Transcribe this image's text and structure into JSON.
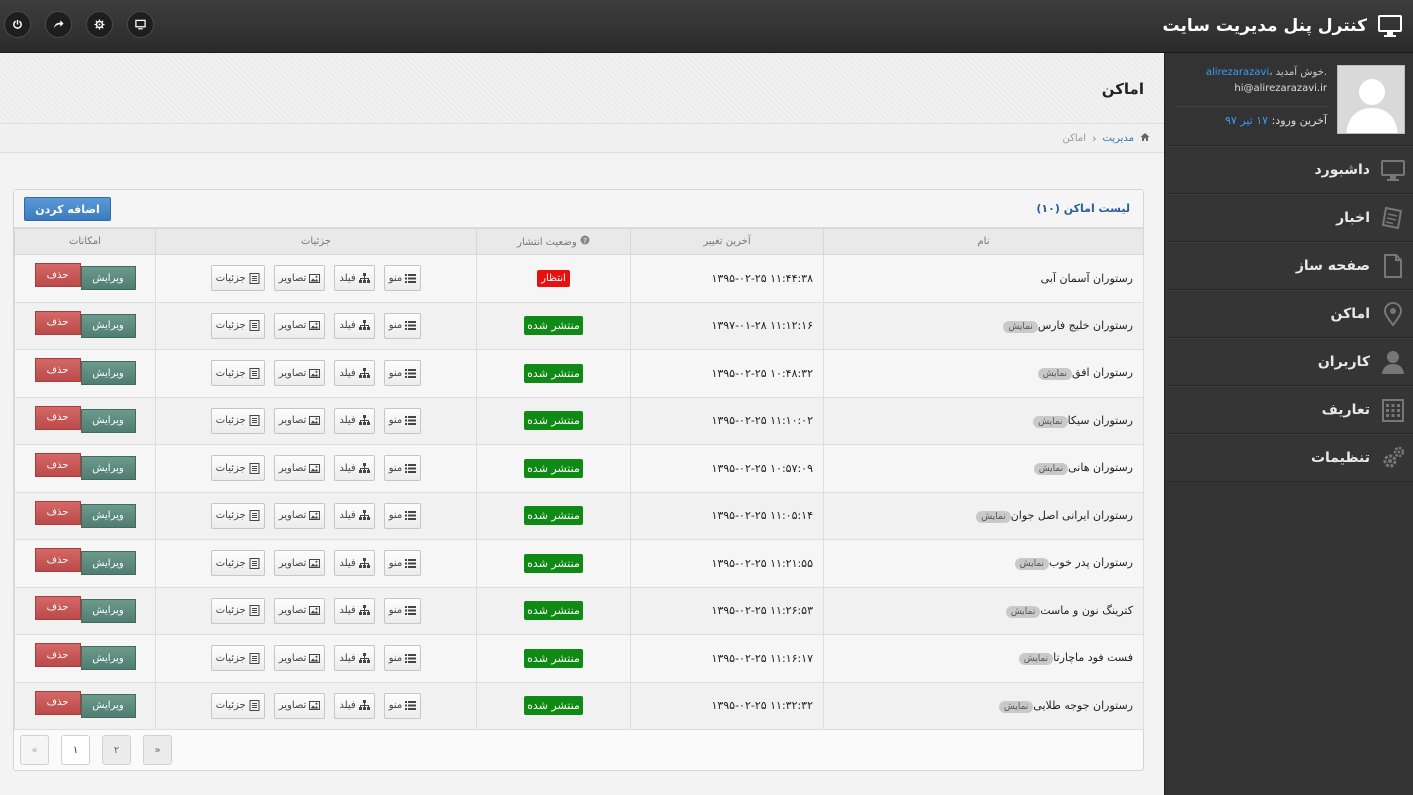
{
  "topbar": {
    "title": "کنترل پنل مدیریت سایت",
    "icons": [
      "power-icon",
      "share-icon",
      "settings-icon",
      "monitor-icon"
    ]
  },
  "profile": {
    "username": "alirezarazavi",
    "welcome": "، خوش آمدید.",
    "email": "hi@alirezarazavi.ir",
    "last_login_label": "آخرین ورود:",
    "last_login_date": "۱۷ تیر ۹۷"
  },
  "nav": [
    {
      "label": "داشبورد",
      "icon": "monitor-icon"
    },
    {
      "label": "اخبار",
      "icon": "news-icon"
    },
    {
      "label": "صفحه ساز",
      "icon": "page-icon"
    },
    {
      "label": "اماکن",
      "icon": "map-pin-icon"
    },
    {
      "label": "کاربران",
      "icon": "user-icon"
    },
    {
      "label": "تعاریف",
      "icon": "grid-icon"
    },
    {
      "label": "تنظیمات",
      "icon": "gears-icon"
    }
  ],
  "page": {
    "title": "اماکن",
    "breadcrumb": {
      "home": "مدیریت",
      "current": "اماکن"
    }
  },
  "panel": {
    "title": "لیست اماکن (۱۰)",
    "add_button": "اضافه کردن",
    "columns": {
      "name": "نام",
      "modified": "آخرین تغییر",
      "status": "وضعیت انتشار",
      "details": "جزئیات",
      "actions": "امکانات"
    },
    "detail_buttons": {
      "menu": "منو",
      "field": "فیلد",
      "images": "تصاویر",
      "details": "جزئیات"
    },
    "action_buttons": {
      "edit": "ویرایش",
      "delete": "حذف"
    },
    "show_badge": "نمایش",
    "rows": [
      {
        "name": "رستوران آسمان آبی",
        "show": false,
        "modified": "۱۳۹۵-۰۲-۲۵ ۱۱:۴۴:۳۸",
        "status": "انتظار",
        "status_type": "wait"
      },
      {
        "name": "رستوران خلیج فارس",
        "show": true,
        "modified": "۱۳۹۷-۰۱-۲۸ ۱۱:۱۲:۱۶",
        "status": "منتشر شده",
        "status_type": "pub"
      },
      {
        "name": "رستوران افق",
        "show": true,
        "modified": "۱۳۹۵-۰۲-۲۵ ۱۰:۴۸:۳۲",
        "status": "منتشر شده",
        "status_type": "pub"
      },
      {
        "name": "رستوران سیکا",
        "show": true,
        "modified": "۱۳۹۵-۰۲-۲۵ ۱۱:۱۰:۰۲",
        "status": "منتشر شده",
        "status_type": "pub"
      },
      {
        "name": "رستوران هانی",
        "show": true,
        "modified": "۱۳۹۵-۰۲-۲۵ ۱۰:۵۷:۰۹",
        "status": "منتشر شده",
        "status_type": "pub"
      },
      {
        "name": "رستوران ایرانی اصل جوان",
        "show": true,
        "modified": "۱۳۹۵-۰۲-۲۵ ۱۱:۰۵:۱۴",
        "status": "منتشر شده",
        "status_type": "pub"
      },
      {
        "name": "رستوران پدر خوب",
        "show": true,
        "modified": "۱۳۹۵-۰۲-۲۵ ۱۱:۲۱:۵۵",
        "status": "منتشر شده",
        "status_type": "pub"
      },
      {
        "name": "کترینگ نون و ماست",
        "show": true,
        "modified": "۱۳۹۵-۰۲-۲۵ ۱۱:۲۶:۵۳",
        "status": "منتشر شده",
        "status_type": "pub"
      },
      {
        "name": "فست فود ماچارتا",
        "show": true,
        "modified": "۱۳۹۵-۰۲-۲۵ ۱۱:۱۶:۱۷",
        "status": "منتشر شده",
        "status_type": "pub"
      },
      {
        "name": "رستوران جوجه طلایی",
        "show": true,
        "modified": "۱۳۹۵-۰۲-۲۵ ۱۱:۳۲:۳۲",
        "status": "منتشر شده",
        "status_type": "pub"
      }
    ]
  },
  "pager": {
    "pages": [
      "«",
      "۲",
      "۱",
      "»"
    ],
    "current": "۱"
  }
}
